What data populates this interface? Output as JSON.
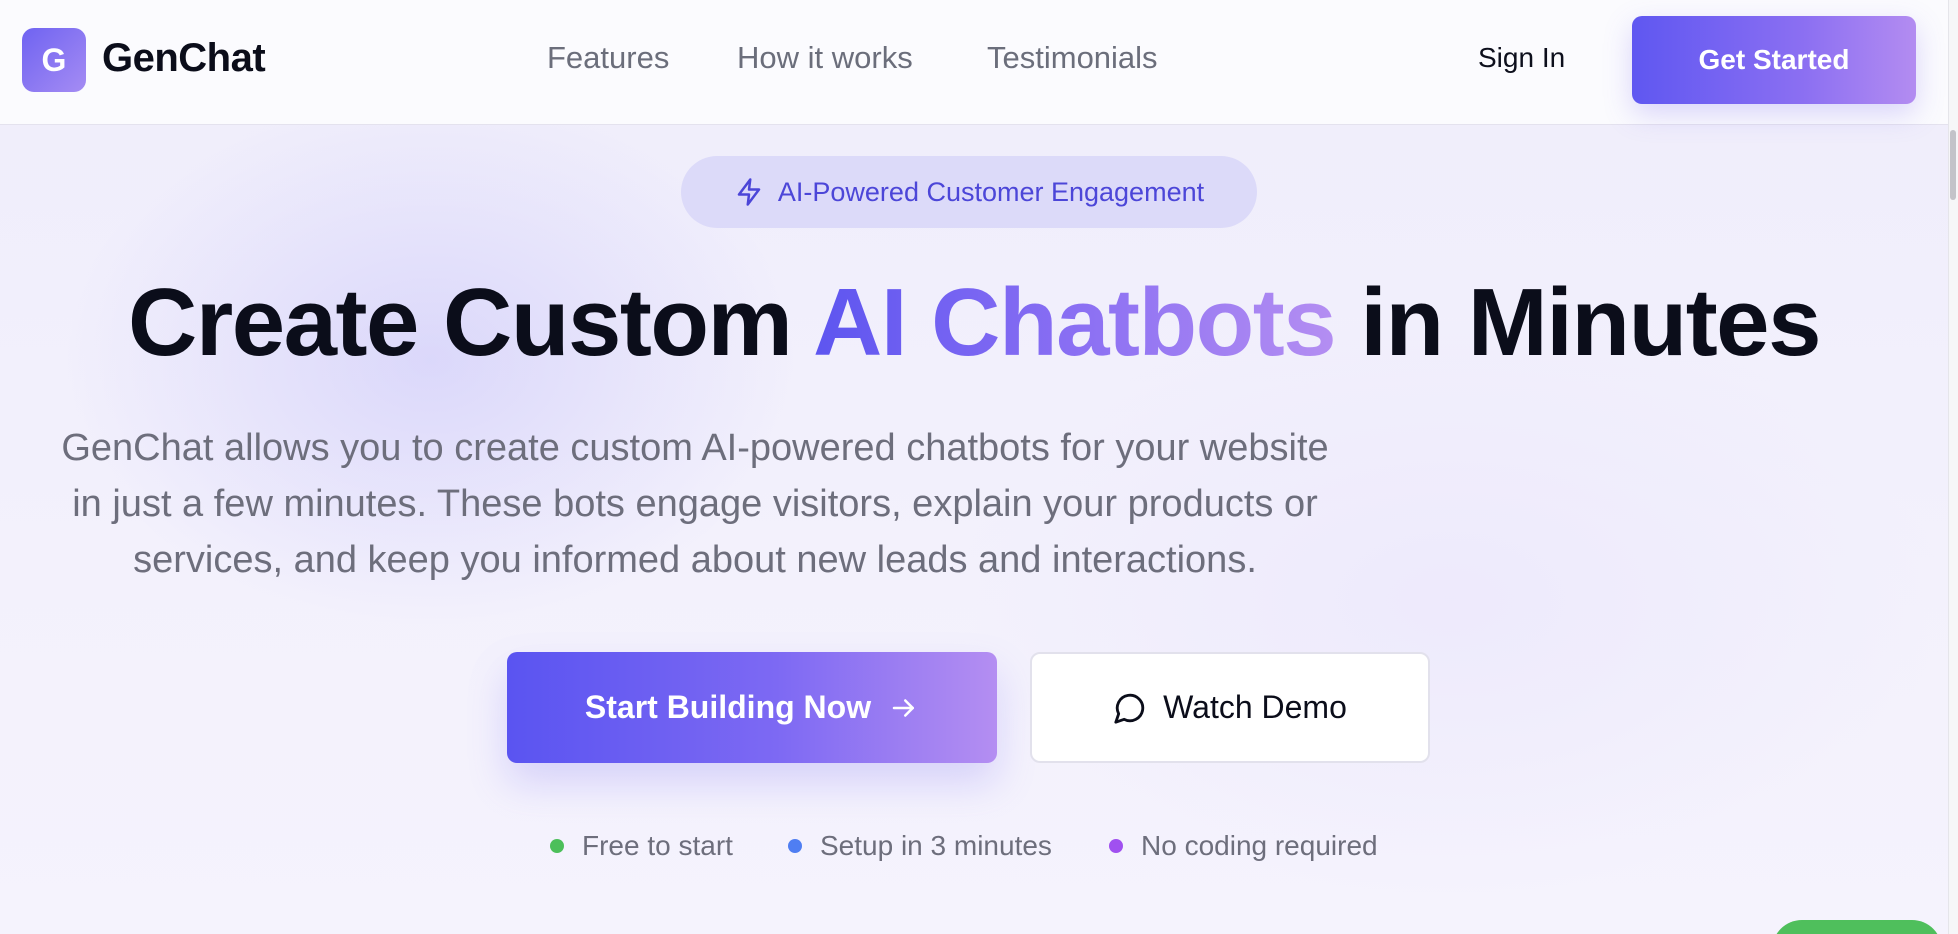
{
  "header": {
    "logo_letter": "G",
    "brand": "GenChat",
    "nav": [
      {
        "label": "Features"
      },
      {
        "label": "How it works"
      },
      {
        "label": "Testimonials"
      }
    ],
    "sign_in": "Sign In",
    "get_started": "Get Started"
  },
  "hero": {
    "badge": {
      "icon": "lightning-icon",
      "text": "AI-Powered Customer Engagement"
    },
    "headline": {
      "before": "Create Custom ",
      "accent": "AI Chatbots",
      "after": " in Minutes"
    },
    "description": [
      "GenChat allows you to create custom AI-powered chatbots for your website",
      "in just a few minutes. These bots engage visitors, explain your products or",
      "services, and keep you informed about new leads and interactions."
    ],
    "primary_button": {
      "label": "Start Building Now",
      "icon": "arrow-right-icon"
    },
    "secondary_button": {
      "label": "Watch Demo",
      "icon": "chat-bubble-icon"
    },
    "features": [
      {
        "label": "Free to start",
        "color": "#4cbf5a"
      },
      {
        "label": "Setup in 3 minutes",
        "color": "#4f7ef2"
      },
      {
        "label": "No coding required",
        "color": "#a050f0"
      }
    ]
  },
  "colors": {
    "accent_start": "#5d55f0",
    "accent_end": "#b48ef2",
    "badge_bg": "#dcdaf9",
    "badge_text": "#4c46d8"
  }
}
